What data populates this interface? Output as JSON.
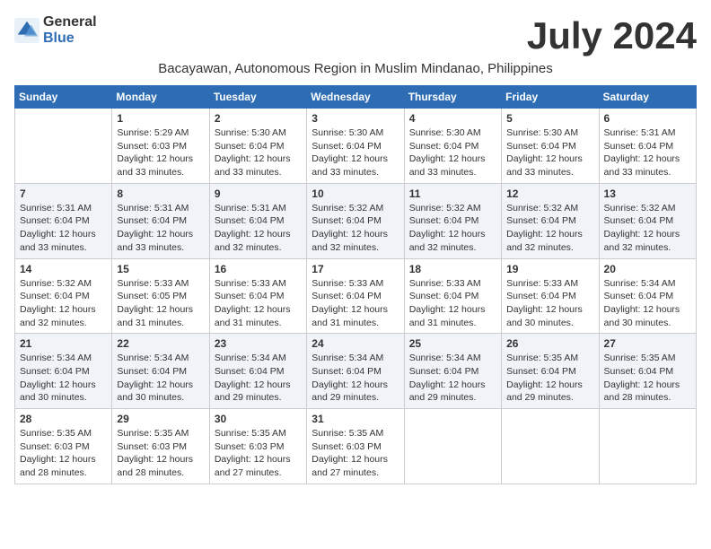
{
  "logo": {
    "general": "General",
    "blue": "Blue"
  },
  "title": "July 2024",
  "subtitle": "Bacayawan, Autonomous Region in Muslim Mindanao, Philippines",
  "days_of_week": [
    "Sunday",
    "Monday",
    "Tuesday",
    "Wednesday",
    "Thursday",
    "Friday",
    "Saturday"
  ],
  "weeks": [
    [
      {
        "day": "",
        "content": ""
      },
      {
        "day": "1",
        "content": "Sunrise: 5:29 AM\nSunset: 6:03 PM\nDaylight: 12 hours\nand 33 minutes."
      },
      {
        "day": "2",
        "content": "Sunrise: 5:30 AM\nSunset: 6:04 PM\nDaylight: 12 hours\nand 33 minutes."
      },
      {
        "day": "3",
        "content": "Sunrise: 5:30 AM\nSunset: 6:04 PM\nDaylight: 12 hours\nand 33 minutes."
      },
      {
        "day": "4",
        "content": "Sunrise: 5:30 AM\nSunset: 6:04 PM\nDaylight: 12 hours\nand 33 minutes."
      },
      {
        "day": "5",
        "content": "Sunrise: 5:30 AM\nSunset: 6:04 PM\nDaylight: 12 hours\nand 33 minutes."
      },
      {
        "day": "6",
        "content": "Sunrise: 5:31 AM\nSunset: 6:04 PM\nDaylight: 12 hours\nand 33 minutes."
      }
    ],
    [
      {
        "day": "7",
        "content": "Sunrise: 5:31 AM\nSunset: 6:04 PM\nDaylight: 12 hours\nand 33 minutes."
      },
      {
        "day": "8",
        "content": "Sunrise: 5:31 AM\nSunset: 6:04 PM\nDaylight: 12 hours\nand 33 minutes."
      },
      {
        "day": "9",
        "content": "Sunrise: 5:31 AM\nSunset: 6:04 PM\nDaylight: 12 hours\nand 32 minutes."
      },
      {
        "day": "10",
        "content": "Sunrise: 5:32 AM\nSunset: 6:04 PM\nDaylight: 12 hours\nand 32 minutes."
      },
      {
        "day": "11",
        "content": "Sunrise: 5:32 AM\nSunset: 6:04 PM\nDaylight: 12 hours\nand 32 minutes."
      },
      {
        "day": "12",
        "content": "Sunrise: 5:32 AM\nSunset: 6:04 PM\nDaylight: 12 hours\nand 32 minutes."
      },
      {
        "day": "13",
        "content": "Sunrise: 5:32 AM\nSunset: 6:04 PM\nDaylight: 12 hours\nand 32 minutes."
      }
    ],
    [
      {
        "day": "14",
        "content": "Sunrise: 5:32 AM\nSunset: 6:04 PM\nDaylight: 12 hours\nand 32 minutes."
      },
      {
        "day": "15",
        "content": "Sunrise: 5:33 AM\nSunset: 6:05 PM\nDaylight: 12 hours\nand 31 minutes."
      },
      {
        "day": "16",
        "content": "Sunrise: 5:33 AM\nSunset: 6:04 PM\nDaylight: 12 hours\nand 31 minutes."
      },
      {
        "day": "17",
        "content": "Sunrise: 5:33 AM\nSunset: 6:04 PM\nDaylight: 12 hours\nand 31 minutes."
      },
      {
        "day": "18",
        "content": "Sunrise: 5:33 AM\nSunset: 6:04 PM\nDaylight: 12 hours\nand 31 minutes."
      },
      {
        "day": "19",
        "content": "Sunrise: 5:33 AM\nSunset: 6:04 PM\nDaylight: 12 hours\nand 30 minutes."
      },
      {
        "day": "20",
        "content": "Sunrise: 5:34 AM\nSunset: 6:04 PM\nDaylight: 12 hours\nand 30 minutes."
      }
    ],
    [
      {
        "day": "21",
        "content": "Sunrise: 5:34 AM\nSunset: 6:04 PM\nDaylight: 12 hours\nand 30 minutes."
      },
      {
        "day": "22",
        "content": "Sunrise: 5:34 AM\nSunset: 6:04 PM\nDaylight: 12 hours\nand 30 minutes."
      },
      {
        "day": "23",
        "content": "Sunrise: 5:34 AM\nSunset: 6:04 PM\nDaylight: 12 hours\nand 29 minutes."
      },
      {
        "day": "24",
        "content": "Sunrise: 5:34 AM\nSunset: 6:04 PM\nDaylight: 12 hours\nand 29 minutes."
      },
      {
        "day": "25",
        "content": "Sunrise: 5:34 AM\nSunset: 6:04 PM\nDaylight: 12 hours\nand 29 minutes."
      },
      {
        "day": "26",
        "content": "Sunrise: 5:35 AM\nSunset: 6:04 PM\nDaylight: 12 hours\nand 29 minutes."
      },
      {
        "day": "27",
        "content": "Sunrise: 5:35 AM\nSunset: 6:04 PM\nDaylight: 12 hours\nand 28 minutes."
      }
    ],
    [
      {
        "day": "28",
        "content": "Sunrise: 5:35 AM\nSunset: 6:03 PM\nDaylight: 12 hours\nand 28 minutes."
      },
      {
        "day": "29",
        "content": "Sunrise: 5:35 AM\nSunset: 6:03 PM\nDaylight: 12 hours\nand 28 minutes."
      },
      {
        "day": "30",
        "content": "Sunrise: 5:35 AM\nSunset: 6:03 PM\nDaylight: 12 hours\nand 27 minutes."
      },
      {
        "day": "31",
        "content": "Sunrise: 5:35 AM\nSunset: 6:03 PM\nDaylight: 12 hours\nand 27 minutes."
      },
      {
        "day": "",
        "content": ""
      },
      {
        "day": "",
        "content": ""
      },
      {
        "day": "",
        "content": ""
      }
    ]
  ]
}
